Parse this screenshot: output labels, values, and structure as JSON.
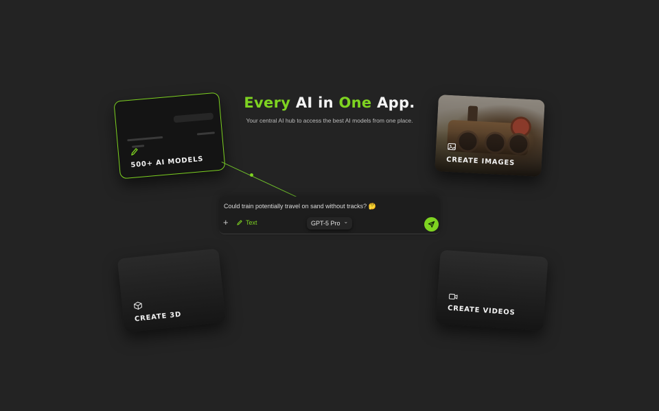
{
  "hero": {
    "title_word1": "Every",
    "title_word2": "AI in",
    "title_word3": "One",
    "title_word4": "App.",
    "subtitle": "Your central AI hub to access the best AI models from one place."
  },
  "cards": {
    "models": {
      "label": "500+ AI MODELS",
      "icon": "pencil-icon"
    },
    "images": {
      "label": "CREATE IMAGES",
      "icon": "image-icon"
    },
    "three_d": {
      "label": "CREATE 3D",
      "icon": "cube-icon"
    },
    "videos": {
      "label": "CREATE VIDEOS",
      "icon": "video-camera-icon"
    }
  },
  "chat": {
    "prompt": "Could train potentially travel on sand without tracks? 🤔",
    "plus": "+",
    "mode_label": "Text",
    "model_label": "GPT-5 Pro",
    "chevron": "⌄"
  },
  "colors": {
    "background": "#232323",
    "accent": "#7ed321"
  }
}
